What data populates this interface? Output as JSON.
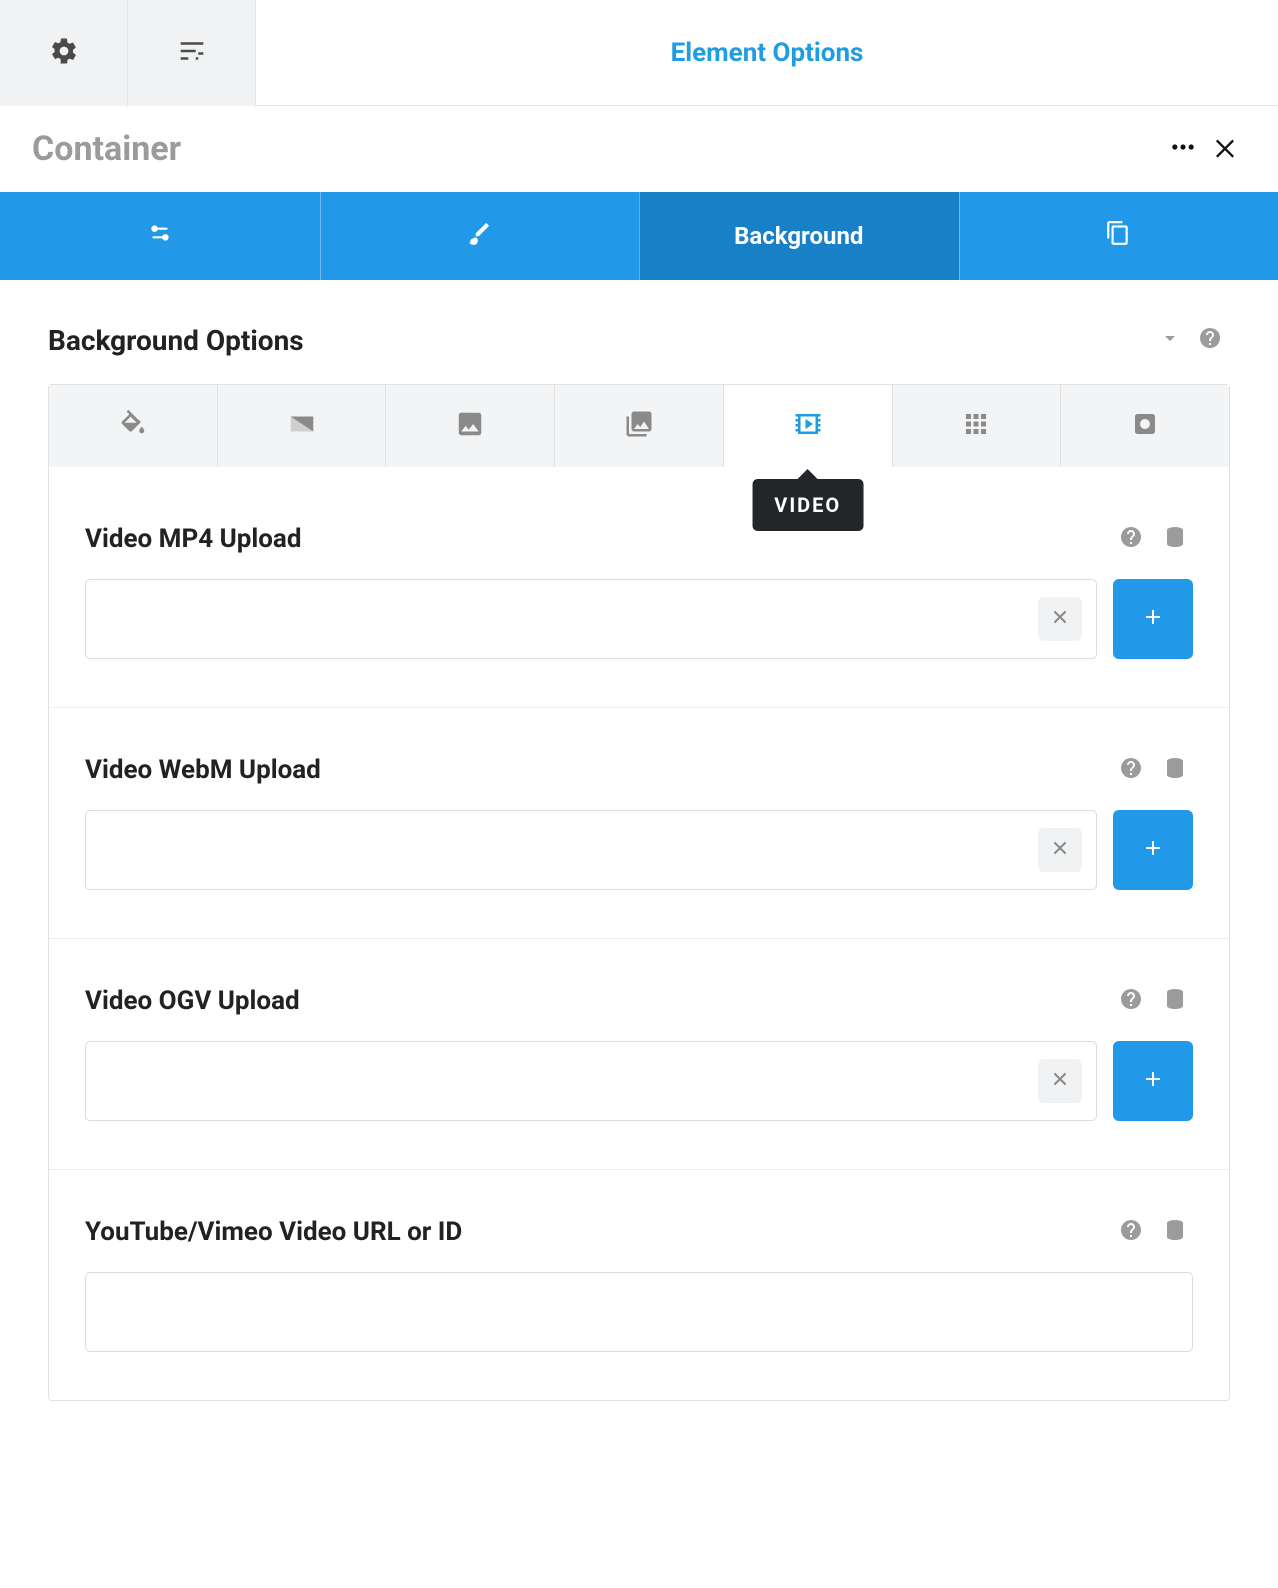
{
  "header": {
    "title": "Element Options"
  },
  "element": {
    "title": "Container"
  },
  "main_tabs": {
    "background_label": "Background"
  },
  "section": {
    "title": "Background Options"
  },
  "subtabs": {
    "tooltip_video": "VIDEO"
  },
  "fields": {
    "mp4": {
      "label": "Video MP4 Upload",
      "value": ""
    },
    "webm": {
      "label": "Video WebM Upload",
      "value": ""
    },
    "ogv": {
      "label": "Video OGV Upload",
      "value": ""
    },
    "url": {
      "label": "YouTube/Vimeo Video URL or ID",
      "value": ""
    }
  }
}
